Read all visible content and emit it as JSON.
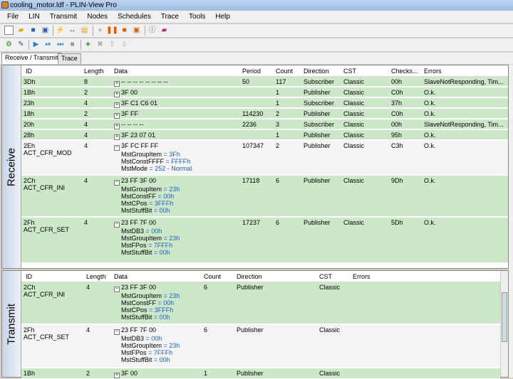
{
  "window": {
    "title": "cooling_motor.ldf - PLIN-View Pro"
  },
  "menu": [
    "File",
    "LIN",
    "Transmit",
    "Nodes",
    "Schedules",
    "Trace",
    "Tools",
    "Help"
  ],
  "tabs": [
    "Receive / Transmit",
    "Trace"
  ],
  "receive": {
    "label": "Receive",
    "headers": [
      "ID",
      "Length",
      "Data",
      "Period",
      "Count",
      "Direction",
      "CST",
      "Checks...",
      "Errors"
    ],
    "rows": [
      {
        "id": "3Dh",
        "name": "",
        "len": "8",
        "data": "-- -- -- -- -- -- -- --",
        "period": "50",
        "count": "117",
        "dir": "Subscriber",
        "cst": "Classic",
        "chk": "00h",
        "err": "SlaveNotResponding, Tim...",
        "exp": "+",
        "signals": []
      },
      {
        "id": "1Bh",
        "name": "",
        "len": "2",
        "data": "3F 00",
        "period": "",
        "count": "1",
        "dir": "Publisher",
        "cst": "Classic",
        "chk": "C0h",
        "err": "O.k.",
        "exp": "+",
        "signals": []
      },
      {
        "id": "23h",
        "name": "",
        "len": "4",
        "data": "3F C1 C6 01",
        "period": "",
        "count": "1",
        "dir": "Subscriber",
        "cst": "Classic",
        "chk": "37h",
        "err": "O.k.",
        "exp": "+",
        "signals": []
      },
      {
        "id": "18h",
        "name": "",
        "len": "2",
        "data": "3F FF",
        "period": "114230",
        "count": "2",
        "dir": "Publisher",
        "cst": "Classic",
        "chk": "C0h",
        "err": "O.k.",
        "exp": "+",
        "signals": []
      },
      {
        "id": "20h",
        "name": "",
        "len": "4",
        "data": "-- -- -- --",
        "period": "2236",
        "count": "3",
        "dir": "Subscriber",
        "cst": "Classic",
        "chk": "00h",
        "err": "SlaveNotResponding, Tim...",
        "exp": "+",
        "signals": []
      },
      {
        "id": "28h",
        "name": "",
        "len": "4",
        "data": "3F 23 07 01",
        "period": "",
        "count": "1",
        "dir": "Publisher",
        "cst": "Classic",
        "chk": "95h",
        "err": "O.k.",
        "exp": "+",
        "signals": []
      },
      {
        "id": "2Eh",
        "name": "ACT_CFR_MOD",
        "len": "4",
        "data": "3F FC FF FF",
        "period": "107347",
        "count": "2",
        "dir": "Publisher",
        "cst": "Classic",
        "chk": "C3h",
        "err": "O.k.",
        "exp": "−",
        "signals": [
          {
            "n": "MstGroupItem",
            "v": "3Fh"
          },
          {
            "n": "MstConstFFFF",
            "v": "FFFFh"
          },
          {
            "n": "MstMode",
            "v": "252 - Normal"
          }
        ]
      },
      {
        "id": "2Ch",
        "name": "ACT_CFR_INI",
        "len": "4",
        "data": "23 FF 3F 00",
        "period": "17118",
        "count": "6",
        "dir": "Publisher",
        "cst": "Classic",
        "chk": "9Dh",
        "err": "O.k.",
        "exp": "−",
        "signals": [
          {
            "n": "MstGroupItem",
            "v": "23h"
          },
          {
            "n": "MstConstFF",
            "v": "00h"
          },
          {
            "n": "MstCPos",
            "v": "3FFFh"
          },
          {
            "n": "MstStuffBit",
            "v": "00h"
          }
        ]
      },
      {
        "id": "2Fh",
        "name": "ACT_CFR_SET",
        "len": "4",
        "data": "23 FF 7F 00",
        "period": "17237",
        "count": "6",
        "dir": "Publisher",
        "cst": "Classic",
        "chk": "5Dh",
        "err": "O.k.",
        "exp": "−",
        "signals": [
          {
            "n": "MstDB3",
            "v": "00h"
          },
          {
            "n": "MstGroupItem",
            "v": "23h"
          },
          {
            "n": "MstFPos",
            "v": "7FFFh"
          },
          {
            "n": "MstStuffBit",
            "v": "00h"
          }
        ]
      }
    ]
  },
  "transmit": {
    "label": "Transmit",
    "headers": [
      "ID",
      "Length",
      "Data",
      "Count",
      "Direction",
      "CST",
      "Errors"
    ],
    "rows": [
      {
        "id": "2Ch",
        "name": "ACT_CFR_INI",
        "len": "4",
        "data": "23 FF 3F 00",
        "count": "6",
        "dir": "Publisher",
        "cst": "Classic",
        "exp": "−",
        "signals": [
          {
            "n": "MstGroupItem",
            "v": "23h"
          },
          {
            "n": "MstConstFF",
            "v": "00h"
          },
          {
            "n": "MstCPos",
            "v": "3FFFh"
          },
          {
            "n": "MstStuffBit",
            "v": "00h"
          }
        ]
      },
      {
        "id": "2Fh",
        "name": "ACT_CFR_SET",
        "len": "4",
        "data": "23 FF 7F 00",
        "count": "6",
        "dir": "Publisher",
        "cst": "Classic",
        "exp": "−",
        "signals": [
          {
            "n": "MstDB3",
            "v": "00h"
          },
          {
            "n": "MstGroupItem",
            "v": "23h"
          },
          {
            "n": "MstFPos",
            "v": "7FFFh"
          },
          {
            "n": "MstStuffBit",
            "v": "00h"
          }
        ]
      },
      {
        "id": "1Bh",
        "name": "",
        "len": "2",
        "data": "3F 00",
        "count": "1",
        "dir": "Publisher",
        "cst": "Classic",
        "exp": "+",
        "signals": []
      }
    ]
  }
}
